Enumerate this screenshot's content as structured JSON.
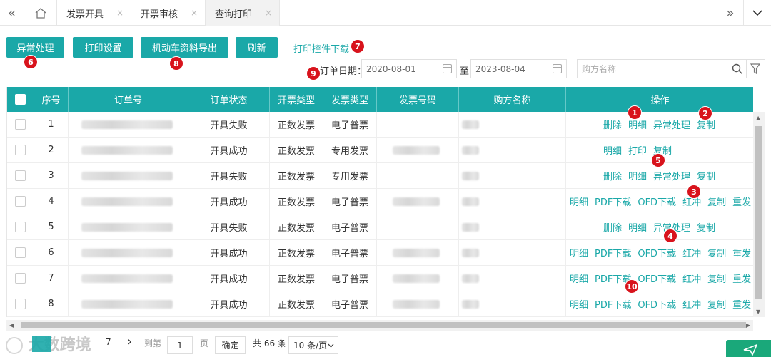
{
  "tabbar": {
    "nav_back": "«",
    "home_icon": "home-icon",
    "tabs": [
      {
        "label": "发票开具",
        "close": "×"
      },
      {
        "label": "开票审核",
        "close": "×"
      },
      {
        "label": "查询打印",
        "close": "×"
      }
    ],
    "nav_forward": "»",
    "dropdown": "⌄"
  },
  "toolbar": {
    "exception": "异常处理",
    "print_settings": "打印设置",
    "vehicle_export": "机动车资料导出",
    "refresh": "刷新",
    "print_plugin": "打印控件下载"
  },
  "filters": {
    "order_date_label": "订单日期：",
    "date_from": "2020-08-01",
    "to_label": "至",
    "date_to": "2023-08-04",
    "buyer_placeholder": "购方名称"
  },
  "table": {
    "headers": [
      "序号",
      "订单号",
      "订单状态",
      "开票类型",
      "发票类型",
      "发票号码",
      "购方名称",
      "操作"
    ],
    "rows": [
      {
        "no": "1",
        "status": "开具失败",
        "kind": "正数发票",
        "type": "电子普票",
        "ops": [
          "删除",
          "明细",
          "异常处理",
          "复制"
        ]
      },
      {
        "no": "2",
        "status": "开具成功",
        "kind": "正数发票",
        "type": "专用发票",
        "ops": [
          "明细",
          "打印",
          "复制"
        ]
      },
      {
        "no": "3",
        "status": "开具失败",
        "kind": "正数发票",
        "type": "专用发票",
        "ops": [
          "删除",
          "明细",
          "异常处理",
          "复制"
        ]
      },
      {
        "no": "4",
        "status": "开具成功",
        "kind": "正数发票",
        "type": "电子普票",
        "ops": [
          "明细",
          "PDF下载",
          "OFD下载",
          "红冲",
          "复制",
          "重发"
        ]
      },
      {
        "no": "5",
        "status": "开具失败",
        "kind": "正数发票",
        "type": "电子普票",
        "ops": [
          "删除",
          "明细",
          "异常处理",
          "复制"
        ]
      },
      {
        "no": "6",
        "status": "开具成功",
        "kind": "正数发票",
        "type": "电子普票",
        "ops": [
          "明细",
          "PDF下载",
          "OFD下载",
          "红冲",
          "复制",
          "重发"
        ]
      },
      {
        "no": "7",
        "status": "开具成功",
        "kind": "正数发票",
        "type": "电子普票",
        "ops": [
          "明细",
          "PDF下载",
          "OFD下载",
          "红冲",
          "复制",
          "重发"
        ]
      },
      {
        "no": "8",
        "status": "开具成功",
        "kind": "正数发票",
        "type": "电子普票",
        "ops": [
          "明细",
          "PDF下载",
          "OFD下载",
          "红冲",
          "复制",
          "重发"
        ]
      }
    ]
  },
  "annotations": [
    "1",
    "2",
    "3",
    "4",
    "5",
    "6",
    "7",
    "8",
    "9",
    "10"
  ],
  "pagination": {
    "last_page": "7",
    "next": "›",
    "goto_label": "到第",
    "page_value": "1",
    "page_unit": "页",
    "confirm": "确定",
    "total": "共 66 条",
    "page_size": "10 条/页"
  },
  "watermark": "大数跨境",
  "colors": {
    "primary": "#1aa8a8",
    "badge": "#d8131c"
  }
}
